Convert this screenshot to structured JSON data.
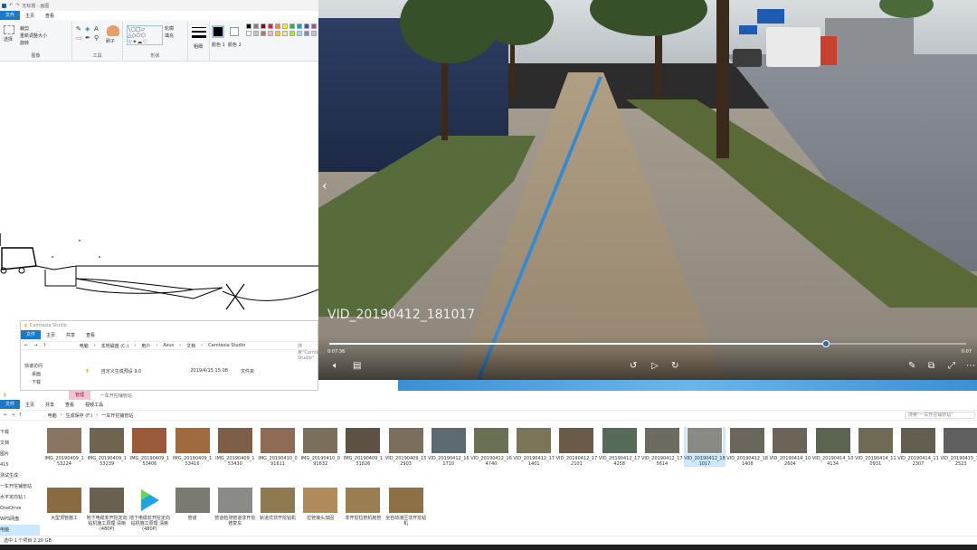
{
  "paint": {
    "title": "无标题 - 画图",
    "tabs": [
      "文件",
      "主页",
      "查看"
    ],
    "ribbon": {
      "groups": [
        "图像",
        "工具",
        "形状"
      ],
      "select_label": "选择",
      "crop_label": "裁剪",
      "resize_label": "重新调整大小",
      "rotate_label": "旋转",
      "brush_label": "刷子",
      "outline_label": "轮廓",
      "fill_label": "填充",
      "size_label": "粗细",
      "color1_label": "颜色 1",
      "color2_label": "颜色 2"
    },
    "palette": [
      "#000000",
      "#7f7f7f",
      "#880015",
      "#ed1c24",
      "#ff7f27",
      "#fff200",
      "#22b14c",
      "#00a2e8",
      "#3f48cc",
      "#a349a4",
      "#ffffff",
      "#c3c3c3",
      "#b97a57",
      "#ffaec9",
      "#ffc90e",
      "#efe4b0",
      "#b5e61d",
      "#99d9ea",
      "#7092be",
      "#c8bfe7"
    ]
  },
  "video": {
    "filename": "VID_20190412_181017",
    "time_current": "0:07:36",
    "time_total": "0:07",
    "progress": 0.78,
    "controls": [
      "volume-icon",
      "subtitles-icon",
      "rewind-icon",
      "play-icon",
      "forward-icon",
      "edit-icon",
      "crop-icon",
      "fullscreen-icon",
      "more-icon"
    ]
  },
  "camtasia_explorer": {
    "title": "Camtasia Studio",
    "tabs": [
      "文件",
      "主页",
      "共享",
      "查看"
    ],
    "path": [
      "电脑",
      "本地磁盘 (C:)",
      "用户",
      "Asus",
      "文档",
      "Camtasia Studio"
    ],
    "search": "搜索\"Camtasia Studio\"",
    "nav": [
      "快速访问",
      "桌面",
      "下载"
    ],
    "row": {
      "name": "自定义生成预设 9.0",
      "date": "2019/4/15 15:08",
      "type": "文件夹"
    }
  },
  "main_explorer": {
    "title": "一车开挖铺管站",
    "manage_tab": "管理",
    "tabs": [
      "文件",
      "主页",
      "共享",
      "查看",
      "视频工具"
    ],
    "path": [
      "电脑",
      "生成保存 (F:)",
      "一车开挖铺管站"
    ],
    "search": "搜索\"一车开挖铺管站\"",
    "nav": [
      "下载",
      "文档",
      "图片",
      "415",
      "测试生成",
      "一车开挖铺管站",
      "水平定向钻 (",
      "OneDrive",
      "WPS网盘",
      "电脑"
    ],
    "status": "选中 1 个项目 2.20 GB",
    "files_row1": [
      {
        "name": "IMG_20190409_153224",
        "kind": "img",
        "color": "#8a7560"
      },
      {
        "name": "IMG_20190409_153239",
        "kind": "img",
        "color": "#6f6450"
      },
      {
        "name": "IMG_20190409_153406",
        "kind": "img",
        "color": "#9a5a3a"
      },
      {
        "name": "IMG_20190409_153416",
        "kind": "img",
        "color": "#a06a3f"
      },
      {
        "name": "IMG_20190409_153430",
        "kind": "img",
        "color": "#7d5e46"
      },
      {
        "name": "IMG_20190410_091611",
        "kind": "img",
        "color": "#8f6a55"
      },
      {
        "name": "IMG_20190410_091632",
        "kind": "img",
        "color": "#7a6f5a"
      },
      {
        "name": "IMG_20190409_151826",
        "kind": "img",
        "color": "#5d5045"
      },
      {
        "name": "VID_20190409_152903",
        "kind": "vid",
        "color": "#7b6e5c"
      },
      {
        "name": "VID_20190412_161710",
        "kind": "vid",
        "color": "#5e6a72"
      },
      {
        "name": "VID_20190412_164740",
        "kind": "vid",
        "color": "#6a7052"
      },
      {
        "name": "VID_20190412_171401",
        "kind": "vid",
        "color": "#7a7558"
      },
      {
        "name": "VID_20190412_172101",
        "kind": "vid",
        "color": "#6a5a48"
      },
      {
        "name": "VID_20190412_174258",
        "kind": "vid",
        "color": "#566a58"
      },
      {
        "name": "VID_20190412_175614",
        "kind": "vid",
        "color": "#6d6a60"
      },
      {
        "name": "VID_20190412_181017",
        "kind": "vid",
        "color": "#8a8a84",
        "selected": true
      },
      {
        "name": "VID_20190412_181408",
        "kind": "vid",
        "color": "#6a665c"
      },
      {
        "name": "VID_20190414_102604",
        "kind": "vid",
        "color": "#6c6458"
      },
      {
        "name": "VID_20190414_104134",
        "kind": "vid",
        "color": "#5a6450"
      },
      {
        "name": "VID_20190414_110931",
        "kind": "vid",
        "color": "#6e6a54"
      },
      {
        "name": "VID_20190414_112307",
        "kind": "vid",
        "color": "#645e50"
      },
      {
        "name": "VID_20190415_102523",
        "kind": "vid",
        "color": "#5f5f5f"
      }
    ],
    "files_row2": [
      {
        "name": "大型顶管施工",
        "kind": "img",
        "color": "#8a6a40"
      },
      {
        "name": "地下电缆非开挖定向钻机施工原理 清晰(480P)",
        "kind": "vid",
        "color": "#6a6050"
      },
      {
        "name": "地下电缆非开挖定向钻机施工原理 清晰(480P)",
        "kind": "app",
        "color": "#ffffff"
      },
      {
        "name": "管道",
        "kind": "img",
        "color": "#7b7a70"
      },
      {
        "name": "管道检测管道非开挖修复车",
        "kind": "img",
        "color": "#8a8a86"
      },
      {
        "name": "轨道式非开挖钻机",
        "kind": "img",
        "color": "#8d7a50"
      },
      {
        "name": "拉管接头加固",
        "kind": "img",
        "color": "#b08a5a"
      },
      {
        "name": "非开挖拉管机拖管",
        "kind": "img",
        "color": "#9a7d50"
      },
      {
        "name": "全自动液压非开挖钻机",
        "kind": "img",
        "color": "#8d7045"
      }
    ]
  }
}
